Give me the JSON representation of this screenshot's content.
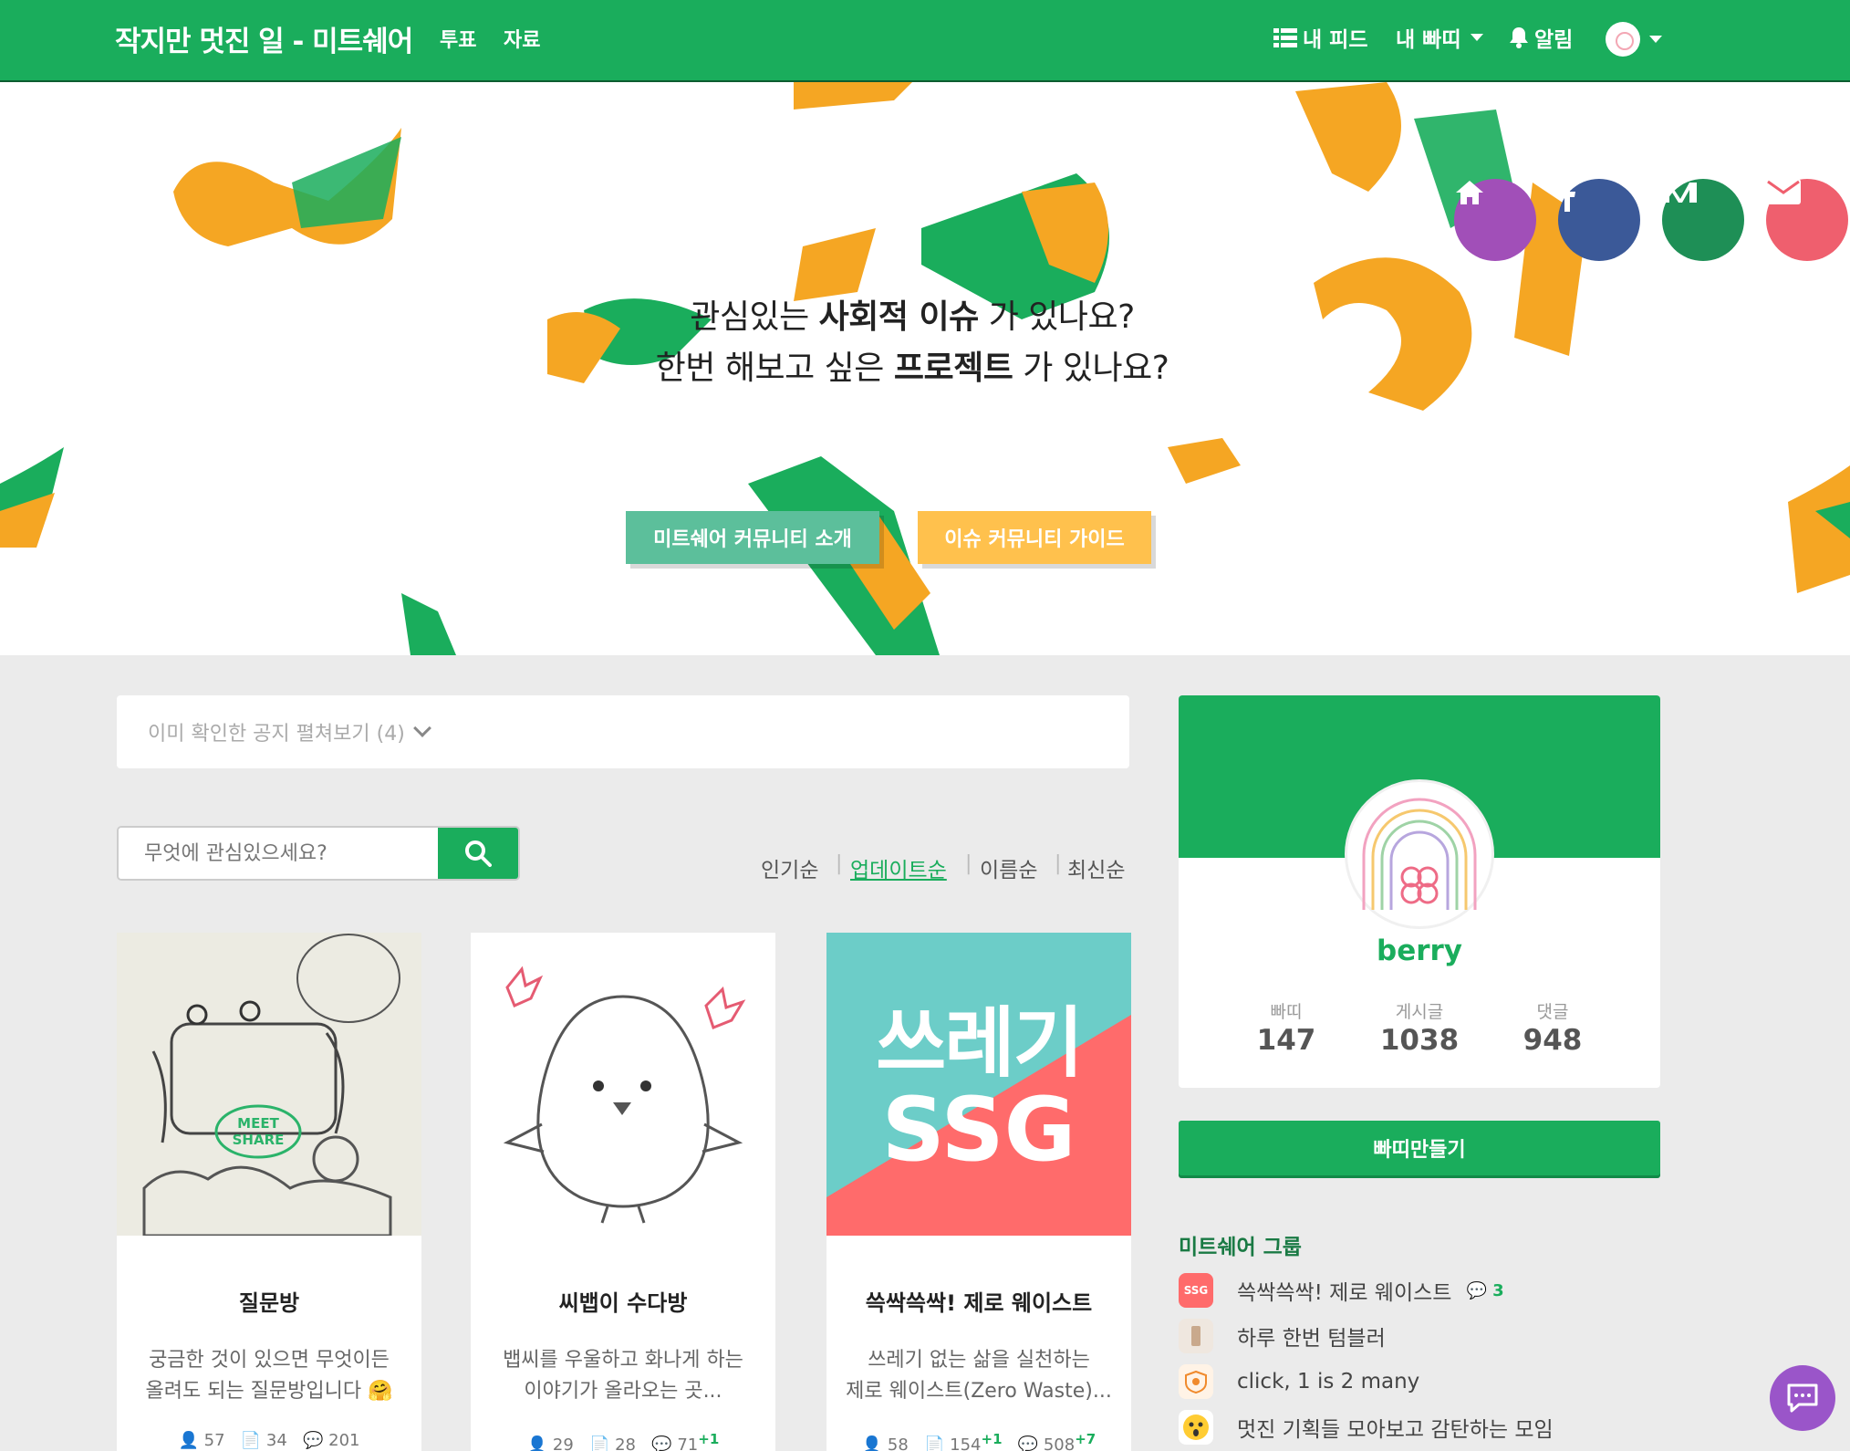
{
  "nav": {
    "brand": "작지만 멋진 일 - 미트쉐어",
    "links": [
      "투표",
      "자료"
    ],
    "my_feed": "내 피드",
    "my_bbati": "내 빠띠",
    "alerts": "알림"
  },
  "hero": {
    "line1_a": "관심있는 ",
    "line1_b": "사회적 이슈",
    "line1_c": " 가 있나요?",
    "line2_a": "한번 해보고 싶은 ",
    "line2_b": "프로젝트",
    "line2_c": " 가 있나요?",
    "btn_intro": "미트쉐어 커뮤니티 소개",
    "btn_guide": "이슈 커뮤니티 가이드",
    "colors": {
      "green": "#1aad5c",
      "orange": "#f5a623",
      "btn_green": "#5cbf9b",
      "btn_orange": "#ffc14d"
    }
  },
  "social": [
    {
      "icon": "home-icon",
      "color": "#a14fb8"
    },
    {
      "icon": "facebook-icon",
      "color": "#3b5998"
    },
    {
      "icon": "medium-icon",
      "color": "#1e8f56"
    },
    {
      "icon": "mail-icon",
      "color": "#ef5f6e"
    }
  ],
  "notice": {
    "label": "이미 확인한 공지 펼쳐보기 (4)"
  },
  "search": {
    "placeholder": "무엇에 관심있으세요?"
  },
  "sort": {
    "options": [
      "인기순",
      "업데이트순",
      "이름순",
      "최신순"
    ],
    "active": "업데이트순"
  },
  "cards": [
    {
      "title": "질문방",
      "desc1": "궁금한 것이 있으면 무엇이든",
      "desc2": "올려도 되는 질문방입니다 🤗",
      "members": "57",
      "posts": "34",
      "posts_plus": "",
      "comments": "201",
      "comments_plus": "",
      "image_label": "MEET SHARE"
    },
    {
      "title": "씨뱁이 수다방",
      "desc1": "뱁씨를 우울하고 화나게 하는",
      "desc2": "이야기가 올라오는 곳...",
      "members": "29",
      "posts": "28",
      "posts_plus": "",
      "comments": "71",
      "comments_plus": "+1",
      "image_label": ""
    },
    {
      "title": "쓱싹쓱싹! 제로 웨이스트",
      "desc1": "쓰레기 없는 삶을 실천하는",
      "desc2": "제로 웨이스트(Zero Waste)...",
      "members": "58",
      "posts": "154",
      "posts_plus": "+1",
      "comments": "508",
      "comments_plus": "+7",
      "image_line1": "쓰레기",
      "image_line2": "SSG"
    }
  ],
  "profile": {
    "name": "berry",
    "stats": [
      {
        "label": "빠띠",
        "value": "147"
      },
      {
        "label": "게시글",
        "value": "1038"
      },
      {
        "label": "댓글",
        "value": "948"
      }
    ]
  },
  "make_button": "빠띠만들기",
  "groups": {
    "title": "미트쉐어 그룹",
    "items": [
      {
        "name": "쓱싹쓱싹! 제로 웨이스트",
        "badge": "3"
      },
      {
        "name": "하루 한번 텀블러",
        "badge": ""
      },
      {
        "name": "click, 1 is 2 many",
        "badge": ""
      },
      {
        "name": "멋진 기획들 모아보고 감탄하는 모임",
        "badge": ""
      }
    ]
  }
}
